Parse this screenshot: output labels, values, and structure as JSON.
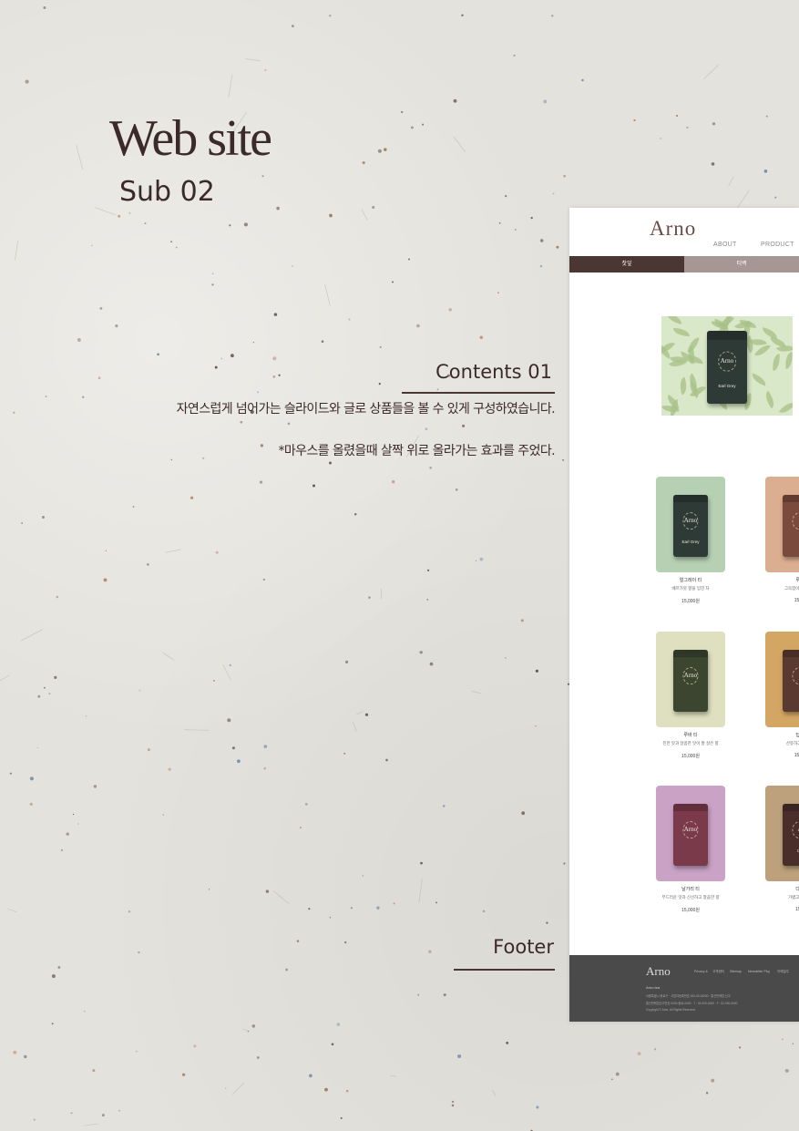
{
  "title": {
    "main": "Web site",
    "sub": "Sub 02"
  },
  "sections": {
    "contents": {
      "heading": "Contents 01",
      "desc1": "자연스럽게 넘어가는 슬라이드와 글로 상품들을 볼 수 있게 구성하였습니다.",
      "desc2": "*마우스를 올렸을때 살짝 위로 올라가는 효과를 주었다."
    },
    "footer": {
      "heading": "Footer"
    }
  },
  "mockup": {
    "logo": "Arno",
    "nav": [
      "ABOUT",
      "PRODUCT"
    ],
    "tabs": [
      {
        "label": "찻잎",
        "color": "#4a3632"
      },
      {
        "label": "티백",
        "color": "#a69694"
      }
    ],
    "hero": {
      "tin_logo": "Arno",
      "tin_name": "Earl Grey"
    },
    "products": [
      {
        "name": "얼그레이 티",
        "desc": "베르가못 향을 입힌 차",
        "price": "15,000원",
        "bg": "#b6d0b4",
        "tin": "#2e3a36",
        "label": "Arno",
        "tinname": "Earl Grey"
      },
      {
        "name": "루이",
        "desc": "그윽함이 독특하고",
        "price": "15,00",
        "bg": "#dcae91",
        "tin": "#7a4a3c",
        "label": "",
        "tinname": ""
      },
      {
        "name": "루바 티",
        "desc": "진한 맛과 달콤한 맛이 잘 살은 향",
        "price": "15,000원",
        "bg": "#dfe0bf",
        "tin": "#3c4530",
        "label": "Arno",
        "tinname": ""
      },
      {
        "name": "딥블",
        "desc": "산뜻하고 신선한",
        "price": "15,00",
        "bg": "#d4a663",
        "tin": "#5a3a30",
        "label": "",
        "tinname": ""
      },
      {
        "name": "날가리 티",
        "desc": "부드러운 맛과 신선하고 깔끔한 향",
        "price": "15,000원",
        "bg": "#c9a2c6",
        "tin": "#7a3a4a",
        "label": "Arno",
        "tinname": ""
      },
      {
        "name": "다즐",
        "desc": "가볍고 섬세한",
        "price": "15,0",
        "bg": "#bda17c",
        "tin": "#4a2e2a",
        "label": "A",
        "tinname": "Da"
      }
    ],
    "footer": {
      "logo": "Arno",
      "nav": [
        "Privacy & ",
        "고객센터",
        "Sitemap",
        "Newsletter Pkg",
        "이메일주"
      ],
      "company": "Arno tea",
      "lines": [
        "서울특별시 종로구 · 사업자등록번호 000-00-00000 · 통신판매업 신고",
        "통신판매업신고번호 0000-종로-0000 · T : 02-000-0000 · F : 02-000-0000",
        "Copyright © Arno. All Rights Reserved."
      ]
    }
  }
}
